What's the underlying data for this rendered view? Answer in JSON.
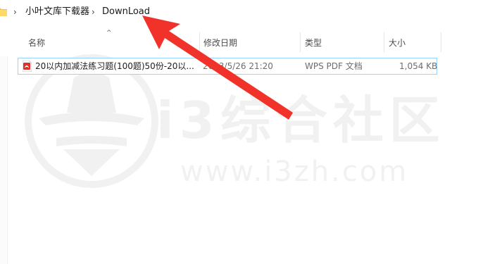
{
  "breadcrumb": {
    "items": [
      "小叶文库下载器",
      "DownLoad"
    ]
  },
  "columns": {
    "name": "名称",
    "modified": "修改日期",
    "type": "类型",
    "size": "大小"
  },
  "files": [
    {
      "name": "20以内加减法练习题(100题)50份-20以...",
      "modified": "2023/5/26 21:20",
      "type": "WPS PDF 文档",
      "size": "1,054 KB"
    }
  ],
  "watermark": {
    "title": "i3综合社区",
    "url": "www.i3zh.com"
  },
  "colors": {
    "arrow": "#f0322a",
    "selection_border": "#99d1ff",
    "pdf_icon": "#d9342b"
  },
  "icons": [
    "folder-icon",
    "chevron-right-icon",
    "sort-up-icon",
    "pdf-file-icon",
    "watermark-spy-logo"
  ]
}
